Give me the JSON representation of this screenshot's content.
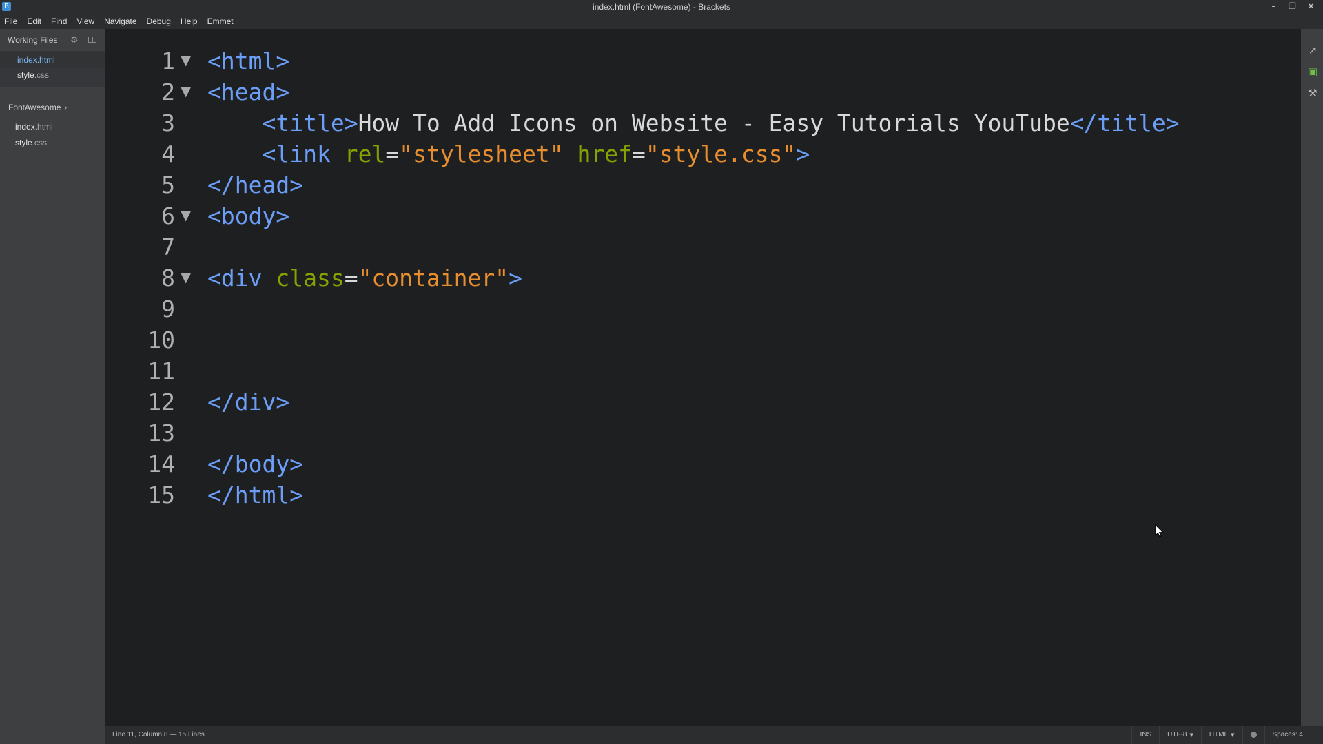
{
  "window": {
    "title": "index.html (FontAwesome) - Brackets",
    "app_icon_glyph": "B",
    "controls": {
      "minimize": "–",
      "maximize": "❐",
      "close": "✕"
    }
  },
  "menu": [
    "File",
    "Edit",
    "Find",
    "View",
    "Navigate",
    "Debug",
    "Help",
    "Emmet"
  ],
  "sidebar": {
    "working_files_label": "Working Files",
    "working_files": [
      {
        "name": "index",
        "ext": ".html",
        "active": true
      },
      {
        "name": "style",
        "ext": ".css",
        "active": false
      }
    ],
    "project_label": "FontAwesome",
    "project_caret": "▾",
    "project_files": [
      {
        "name": "index",
        "ext": ".html"
      },
      {
        "name": "style",
        "ext": ".css"
      }
    ]
  },
  "editor": {
    "fold_glyph": "▼",
    "lines": [
      {
        "num": "1",
        "fold": true,
        "indent": "",
        "tokens": [
          {
            "t": "t",
            "v": "<html>"
          }
        ]
      },
      {
        "num": "2",
        "fold": true,
        "indent": "",
        "tokens": [
          {
            "t": "t",
            "v": "<head>"
          }
        ]
      },
      {
        "num": "3",
        "fold": false,
        "indent": "    ",
        "tokens": [
          {
            "t": "t",
            "v": "<title>"
          },
          {
            "t": "p",
            "v": "How To Add Icons on Website - Easy Tutorials YouTube"
          },
          {
            "t": "t",
            "v": "</title>"
          }
        ]
      },
      {
        "num": "4",
        "fold": false,
        "indent": "    ",
        "tokens": [
          {
            "t": "t",
            "v": "<link "
          },
          {
            "t": "a",
            "v": "rel"
          },
          {
            "t": "p",
            "v": "="
          },
          {
            "t": "s",
            "v": "\"stylesheet\""
          },
          {
            "t": "p",
            "v": " "
          },
          {
            "t": "a",
            "v": "href"
          },
          {
            "t": "p",
            "v": "="
          },
          {
            "t": "s",
            "v": "\"style.css\""
          },
          {
            "t": "t",
            "v": ">"
          }
        ]
      },
      {
        "num": "5",
        "fold": false,
        "indent": "",
        "tokens": [
          {
            "t": "t",
            "v": "</head>"
          }
        ]
      },
      {
        "num": "6",
        "fold": true,
        "indent": "",
        "tokens": [
          {
            "t": "t",
            "v": "<body>"
          }
        ]
      },
      {
        "num": "7",
        "fold": false,
        "indent": "",
        "tokens": []
      },
      {
        "num": "8",
        "fold": true,
        "indent": "",
        "tokens": [
          {
            "t": "t",
            "v": "<div "
          },
          {
            "t": "a",
            "v": "class"
          },
          {
            "t": "p",
            "v": "="
          },
          {
            "t": "s",
            "v": "\"container\""
          },
          {
            "t": "t",
            "v": ">"
          }
        ]
      },
      {
        "num": "9",
        "fold": false,
        "indent": "",
        "tokens": []
      },
      {
        "num": "10",
        "fold": false,
        "indent": "",
        "tokens": []
      },
      {
        "num": "11",
        "fold": false,
        "indent": "",
        "tokens": []
      },
      {
        "num": "12",
        "fold": false,
        "indent": "",
        "tokens": [
          {
            "t": "t",
            "v": "</div>"
          }
        ]
      },
      {
        "num": "13",
        "fold": false,
        "indent": "",
        "tokens": []
      },
      {
        "num": "14",
        "fold": false,
        "indent": "",
        "tokens": [
          {
            "t": "t",
            "v": "</body>"
          }
        ]
      },
      {
        "num": "15",
        "fold": false,
        "indent": "",
        "tokens": [
          {
            "t": "t",
            "v": "</html>"
          }
        ]
      }
    ]
  },
  "right_toolbar": [
    {
      "icon": "live-preview-icon",
      "glyph": "↗"
    },
    {
      "icon": "extension-manager-icon",
      "glyph": "▣"
    },
    {
      "icon": "tools-icon",
      "glyph": "⚒"
    }
  ],
  "status": {
    "cursor_position": "Line 11, Column 8 — 15 Lines",
    "mode": "INS",
    "encoding": "UTF-8",
    "language": "HTML",
    "indent": "Spaces: 4"
  },
  "colors": {
    "tag": "#6c9ef8",
    "attribute": "#85a300",
    "string": "#e88e2e",
    "text": "#d8d8d8",
    "active_file": "#7cb5f2"
  }
}
